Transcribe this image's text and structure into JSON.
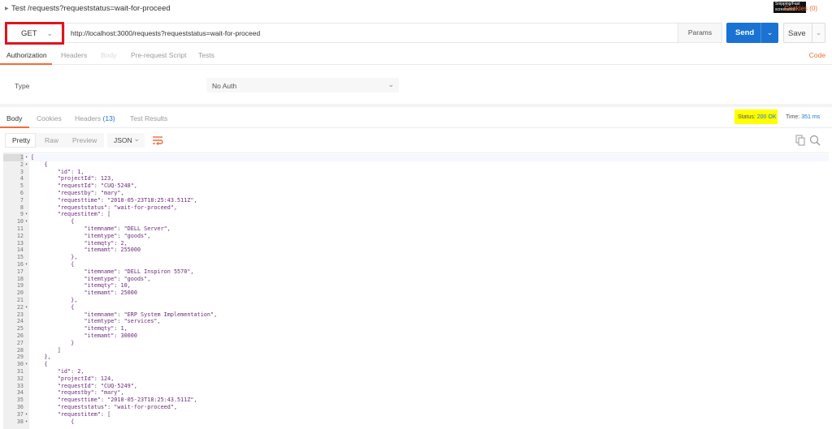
{
  "request": {
    "title": "Test /requests?requeststatus=wait-for-proceed",
    "cookies_label": "Cookies (0)",
    "watermark": "Snipping/Fast screenshot",
    "method": "GET",
    "url": "http://localhost:3000/requests?requeststatus=wait-for-proceed",
    "params_label": "Params",
    "send_label": "Send",
    "save_label": "Save"
  },
  "request_tabs": [
    "Authorization",
    "Headers",
    "Body",
    "Pre-request Script",
    "Tests"
  ],
  "code_link": "Code",
  "auth": {
    "type_label": "Type",
    "type_value": "No Auth"
  },
  "response": {
    "tabs": {
      "body": "Body",
      "cookies": "Cookies",
      "headers": "Headers",
      "headers_count": "(13)",
      "tests": "Test Results"
    },
    "status_label": "Status:",
    "status_value": "200 OK",
    "time_label": "Time:",
    "time_value": "351 ms"
  },
  "format": {
    "pretty": "Pretty",
    "raw": "Raw",
    "preview": "Preview",
    "language": "JSON"
  },
  "icons": {
    "method_chevron": "chevron-down-icon",
    "wrap": "wrap-lines-icon",
    "copy": "copy-icon",
    "search": "search-icon"
  },
  "colors": {
    "accent": "#f26b3a",
    "send": "#1a73d2",
    "highlight": "#ffff00",
    "annotation": "#e0141e"
  },
  "code_lines": [
    {
      "n": "1",
      "fold": "▾",
      "text": "["
    },
    {
      "n": "2",
      "fold": "▾",
      "text": "    {"
    },
    {
      "n": "3",
      "fold": "",
      "text": "        \"id\": 1,"
    },
    {
      "n": "4",
      "fold": "",
      "text": "        \"projectId\": 123,"
    },
    {
      "n": "5",
      "fold": "",
      "text": "        \"requestId\": \"CUQ-5248\","
    },
    {
      "n": "6",
      "fold": "",
      "text": "        \"requestby\": \"mary\","
    },
    {
      "n": "7",
      "fold": "",
      "text": "        \"requesttime\": \"2018-05-23T18:25:43.511Z\","
    },
    {
      "n": "8",
      "fold": "",
      "text": "        \"requeststatus\": \"wait-for-proceed\","
    },
    {
      "n": "9",
      "fold": "▾",
      "text": "        \"requestitem\": ["
    },
    {
      "n": "10",
      "fold": "▾",
      "text": "            {"
    },
    {
      "n": "11",
      "fold": "",
      "text": "                \"itemname\": \"DELL Server\","
    },
    {
      "n": "12",
      "fold": "",
      "text": "                \"itemtype\": \"goods\","
    },
    {
      "n": "13",
      "fold": "",
      "text": "                \"itemqty\": 2,"
    },
    {
      "n": "14",
      "fold": "",
      "text": "                \"itemamt\": 255000"
    },
    {
      "n": "15",
      "fold": "",
      "text": "            },"
    },
    {
      "n": "16",
      "fold": "▾",
      "text": "            {"
    },
    {
      "n": "17",
      "fold": "",
      "text": "                \"itemname\": \"DELL Inspiron 5570\","
    },
    {
      "n": "18",
      "fold": "",
      "text": "                \"itemtype\": \"goods\","
    },
    {
      "n": "19",
      "fold": "",
      "text": "                \"itemqty\": 10,"
    },
    {
      "n": "20",
      "fold": "",
      "text": "                \"itemamt\": 25000"
    },
    {
      "n": "21",
      "fold": "",
      "text": "            },"
    },
    {
      "n": "22",
      "fold": "▾",
      "text": "            {"
    },
    {
      "n": "23",
      "fold": "",
      "text": "                \"itemname\": \"ERP System Implementation\","
    },
    {
      "n": "24",
      "fold": "",
      "text": "                \"itemtype\": \"services\","
    },
    {
      "n": "25",
      "fold": "",
      "text": "                \"itemqty\": 1,"
    },
    {
      "n": "26",
      "fold": "",
      "text": "                \"itemamt\": 30000"
    },
    {
      "n": "27",
      "fold": "",
      "text": "            }"
    },
    {
      "n": "28",
      "fold": "",
      "text": "        ]"
    },
    {
      "n": "29",
      "fold": "",
      "text": "    },"
    },
    {
      "n": "30",
      "fold": "▾",
      "text": "    {"
    },
    {
      "n": "31",
      "fold": "",
      "text": "        \"id\": 2,"
    },
    {
      "n": "32",
      "fold": "",
      "text": "        \"projectId\": 124,"
    },
    {
      "n": "33",
      "fold": "",
      "text": "        \"requestId\": \"CUQ-5249\","
    },
    {
      "n": "34",
      "fold": "",
      "text": "        \"requestby\": \"mary\","
    },
    {
      "n": "35",
      "fold": "",
      "text": "        \"requesttime\": \"2018-05-23T18:25:43.511Z\","
    },
    {
      "n": "36",
      "fold": "",
      "text": "        \"requeststatus\": \"wait-for-proceed\","
    },
    {
      "n": "37",
      "fold": "▾",
      "text": "        \"requestitem\": ["
    },
    {
      "n": "38",
      "fold": "▾",
      "text": "            {"
    }
  ]
}
